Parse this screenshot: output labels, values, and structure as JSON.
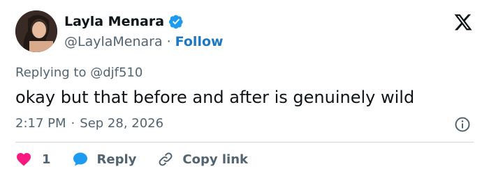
{
  "tweet": {
    "display_name": "Layla Menara",
    "handle": "@LaylaMenara",
    "separator": "·",
    "follow_label": "Follow",
    "replying_prefix": "Replying to",
    "replying_to": "@djf510",
    "text": "okay but that before and after is genuinely wild",
    "time": "2:17 PM",
    "date": "Sep 28, 2026",
    "likes": "1",
    "reply_label": "Reply",
    "copy_link_label": "Copy link"
  },
  "colors": {
    "verified": "#1d9bf0",
    "follow": "#1d77c2",
    "heart": "#f91880",
    "reply_bubble": "#1d9bf0",
    "muted": "#536471"
  },
  "icons": [
    "verified-badge-icon",
    "x-logo-icon",
    "info-icon",
    "heart-icon",
    "reply-bubble-icon",
    "link-icon"
  ]
}
